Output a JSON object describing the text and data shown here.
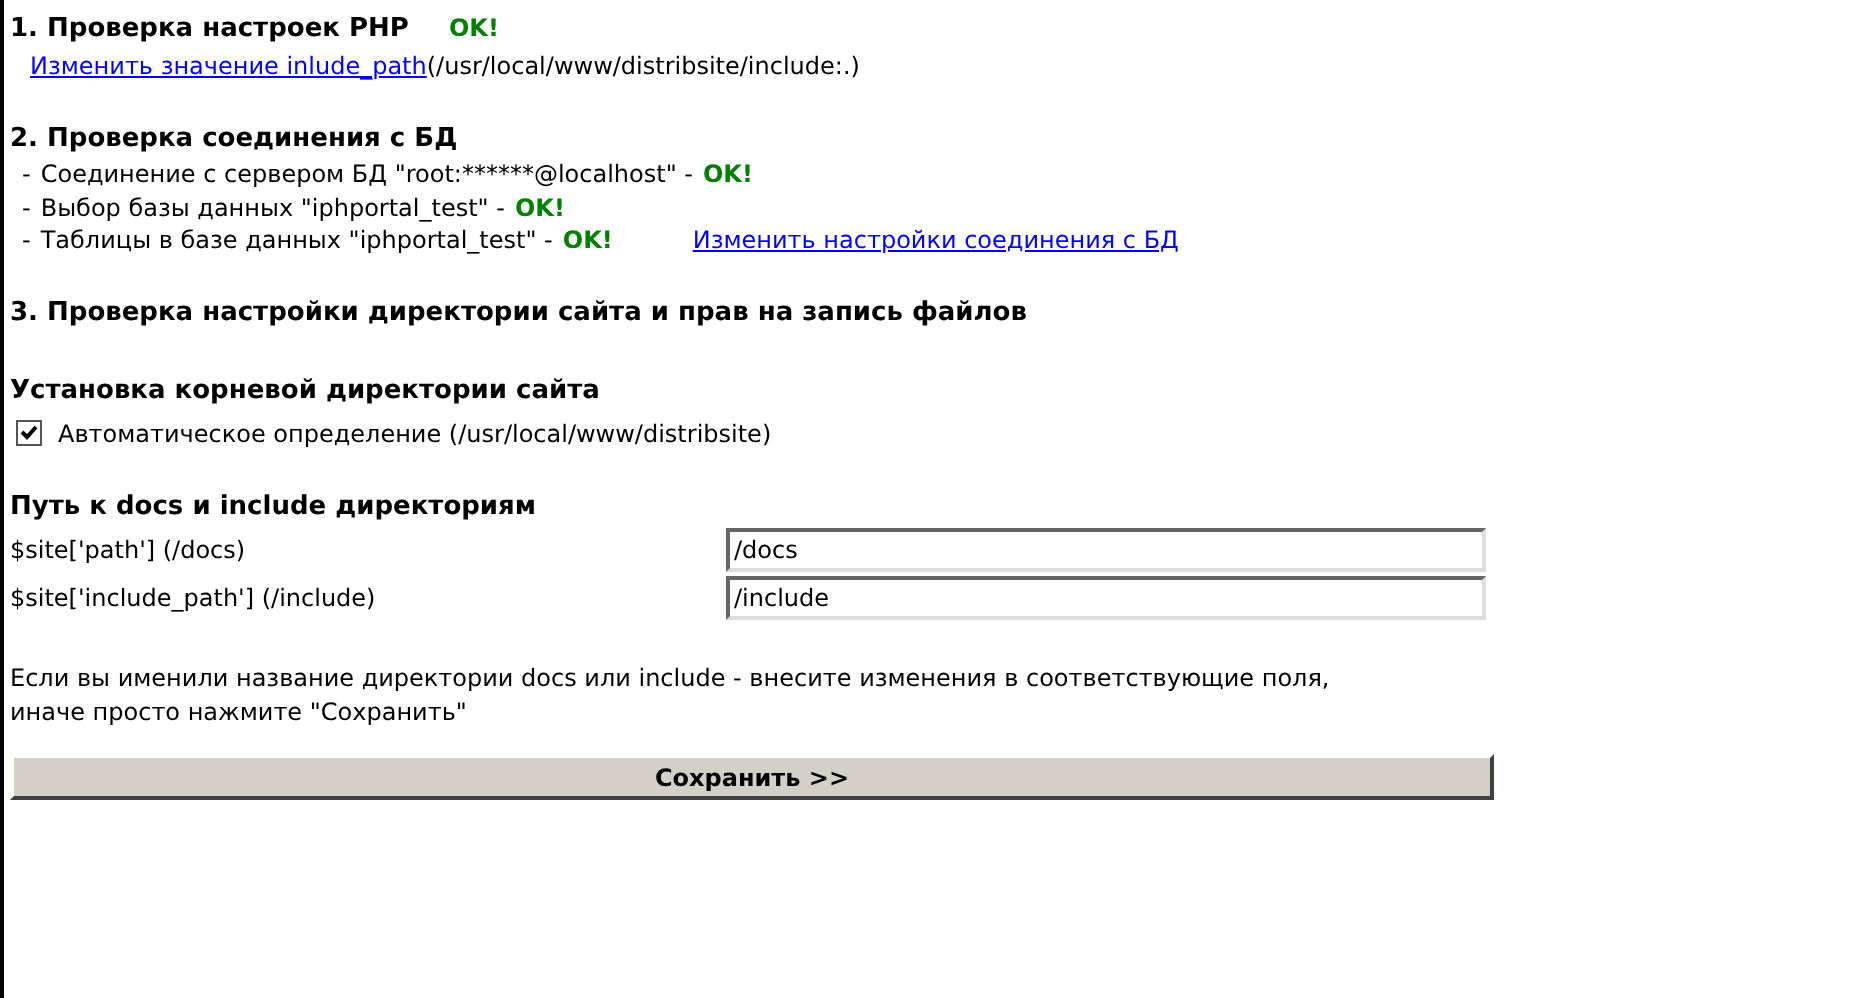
{
  "php_check": {
    "title": "1. Проверка настроек PHP",
    "status": "OK!",
    "link": "Изменить значение inlude_path",
    "path": "(/usr/local/www/distribsite/include:.)"
  },
  "db_check": {
    "title": "2. Проверка соединения с БД",
    "items": [
      {
        "bullet": "-",
        "text": "Соединение с сервером БД \"root:******@localhost\" -",
        "status": "OK!"
      },
      {
        "bullet": "-",
        "text": "Выбор базы данных \"iphportal_test\" -",
        "status": "OK!"
      },
      {
        "bullet": "-",
        "text": "Таблицы в базе данных \"iphportal_test\" -",
        "status": "OK!",
        "link": "Изменить настройки соединения с БД"
      }
    ]
  },
  "dir_check": {
    "title": "3. Проверка настройки директории сайта и прав на запись файлов"
  },
  "root_dir": {
    "title": "Установка корневой директории сайта",
    "checkbox": {
      "label": "Автоматическое определение (/usr/local/www/distribsite)",
      "checked": true
    }
  },
  "paths": {
    "title": "Путь к docs и include директориям",
    "fields": [
      {
        "label": "$site['path'] (/docs)",
        "value": "/docs"
      },
      {
        "label": "$site['include_path'] (/include)",
        "value": "/include"
      }
    ]
  },
  "note": "Если вы именили название директории docs или include - внесите изменения в соответствующие поля, иначе просто нажмите \"Сохранить\"",
  "save_button": "Сохранить >>"
}
